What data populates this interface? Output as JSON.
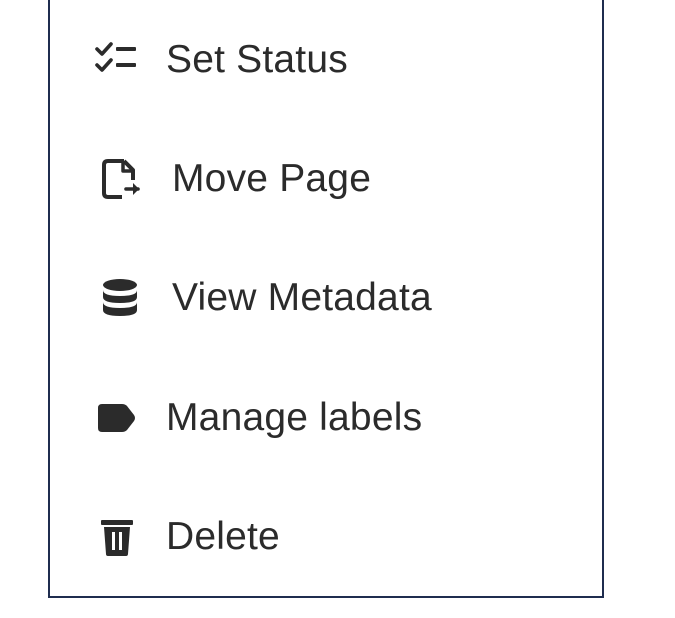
{
  "menu": {
    "items": [
      {
        "label": "Set Status",
        "icon": "checklist-icon"
      },
      {
        "label": "Move Page",
        "icon": "move-page-icon"
      },
      {
        "label": "View Metadata",
        "icon": "database-icon"
      },
      {
        "label": "Manage labels",
        "icon": "label-icon"
      },
      {
        "label": "Delete",
        "icon": "trash-icon"
      }
    ]
  },
  "colors": {
    "text": "#2b2b2b",
    "icon": "#2b2b2b",
    "border": "#1f2d4f",
    "background": "#ffffff"
  }
}
